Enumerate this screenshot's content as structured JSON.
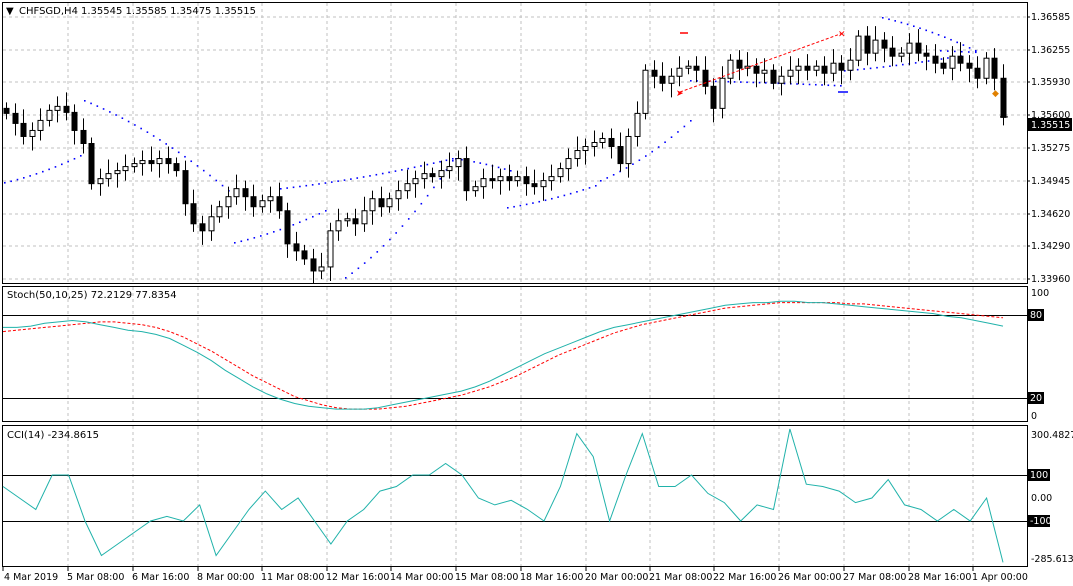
{
  "chart_header": {
    "symbol_timeframe": "CHFSGD,H4",
    "ohlc_text": "1.35545 1.35585 1.35475 1.35515"
  },
  "price_axis": {
    "labels": [
      "1.36585",
      "1.36255",
      "1.35930",
      "1.35600",
      "1.35275",
      "1.34945",
      "1.34620",
      "1.34290",
      "1.33960"
    ],
    "current_price": "1.35515"
  },
  "stoch_panel": {
    "label": "Stoch(50,10,25) 72.2129 77.8354",
    "axis_labels": [
      "100",
      "80",
      "20",
      "0"
    ]
  },
  "cci_panel": {
    "label": "CCI(14) -234.8615",
    "axis_labels": [
      "300.4827",
      "100",
      "0.00",
      "-100",
      "-285.6135"
    ]
  },
  "time_axis": {
    "labels": [
      "4 Mar 2019",
      "5 Mar 08:00",
      "6 Mar 16:00",
      "8 Mar 00:00",
      "11 Mar 08:00",
      "12 Mar 16:00",
      "14 Mar 00:00",
      "15 Mar 08:00",
      "18 Mar 16:00",
      "20 Mar 00:00",
      "21 Mar 08:00",
      "22 Mar 16:00",
      "26 Mar 00:00",
      "27 Mar 08:00",
      "28 Mar 16:00",
      "1 Apr 00:00"
    ]
  },
  "colors": {
    "background": "#ffffff",
    "grid": "#c0c0c0",
    "candle": "#000000",
    "sar_dots": "#0000ff",
    "stoch_main": "#20b2aa",
    "stoch_signal": "#ff0000",
    "cci_line": "#20b2aa",
    "level_line": "#000000",
    "trade_line": "#ff0000"
  },
  "chart_data": {
    "type": "candlestick",
    "symbol": "CHFSGD",
    "timeframe": "H4",
    "ylim": [
      1.3386,
      1.3665
    ],
    "last": 1.35515,
    "close": [
      1.3555,
      1.3545,
      1.3532,
      1.3538,
      1.3548,
      1.3558,
      1.3562,
      1.3556,
      1.3538,
      1.3525,
      1.3485,
      1.349,
      1.3495,
      1.3498,
      1.3502,
      1.3505,
      1.3508,
      1.3505,
      1.351,
      1.3505,
      1.3498,
      1.3465,
      1.3445,
      1.3438,
      1.3452,
      1.3462,
      1.3472,
      1.348,
      1.3472,
      1.3462,
      1.3468,
      1.3472,
      1.3458,
      1.3425,
      1.3418,
      1.341,
      1.3398,
      1.3402,
      1.3438,
      1.3448,
      1.345,
      1.3445,
      1.3458,
      1.347,
      1.3462,
      1.347,
      1.3478,
      1.3485,
      1.349,
      1.3495,
      1.3492,
      1.3498,
      1.3502,
      1.351,
      1.3478,
      1.3482,
      1.349,
      1.3488,
      1.3492,
      1.3488,
      1.3492,
      1.3485,
      1.3482,
      1.3488,
      1.3492,
      1.35,
      1.351,
      1.3518,
      1.3522,
      1.3526,
      1.353,
      1.3522,
      1.3505,
      1.3532,
      1.3555,
      1.3598,
      1.3592,
      1.3585,
      1.3592,
      1.36,
      1.3602,
      1.3598,
      1.3582,
      1.356,
      1.359,
      1.3608,
      1.36,
      1.3602,
      1.3595,
      1.3598,
      1.3585,
      1.3592,
      1.3598,
      1.3602,
      1.3598,
      1.3602,
      1.3595,
      1.3605,
      1.3598,
      1.3608,
      1.3632,
      1.3615,
      1.3628,
      1.362,
      1.3612,
      1.3615,
      1.3625,
      1.3615,
      1.3612,
      1.3605,
      1.36,
      1.3612,
      1.3605,
      1.36,
      1.359,
      1.361,
      1.359,
      1.3551
    ],
    "open": [
      1.356,
      1.3555,
      1.3545,
      1.3532,
      1.3538,
      1.3548,
      1.3558,
      1.3562,
      1.3556,
      1.3538,
      1.3525,
      1.3485,
      1.349,
      1.3495,
      1.3498,
      1.3502,
      1.3505,
      1.3508,
      1.3505,
      1.351,
      1.3505,
      1.3498,
      1.3465,
      1.3445,
      1.3438,
      1.3452,
      1.3462,
      1.3472,
      1.348,
      1.3472,
      1.3462,
      1.3468,
      1.3472,
      1.3458,
      1.3425,
      1.3418,
      1.341,
      1.3398,
      1.3402,
      1.3438,
      1.3448,
      1.345,
      1.3445,
      1.3458,
      1.347,
      1.3462,
      1.347,
      1.3478,
      1.3485,
      1.349,
      1.3495,
      1.3492,
      1.3498,
      1.3502,
      1.351,
      1.3478,
      1.3482,
      1.349,
      1.3488,
      1.3492,
      1.3488,
      1.3492,
      1.3485,
      1.3482,
      1.3488,
      1.3492,
      1.35,
      1.351,
      1.3518,
      1.3522,
      1.3526,
      1.353,
      1.3522,
      1.3505,
      1.3532,
      1.3555,
      1.3598,
      1.3592,
      1.3585,
      1.3592,
      1.36,
      1.3602,
      1.3598,
      1.3582,
      1.356,
      1.359,
      1.3608,
      1.36,
      1.3602,
      1.3595,
      1.3598,
      1.3585,
      1.3592,
      1.3598,
      1.3602,
      1.3598,
      1.3602,
      1.3595,
      1.3605,
      1.3598,
      1.3608,
      1.3632,
      1.3615,
      1.3628,
      1.362,
      1.3612,
      1.3615,
      1.3625,
      1.3615,
      1.3612,
      1.3605,
      1.36,
      1.3612,
      1.3605,
      1.36,
      1.359,
      1.361,
      1.359
    ],
    "stoch_main": [
      71,
      71,
      72,
      74,
      75,
      76,
      75,
      73,
      71,
      69,
      68,
      66,
      63,
      58,
      53,
      47,
      40,
      34,
      28,
      23,
      19,
      16,
      14,
      13,
      12,
      12,
      12,
      13,
      15,
      17,
      19,
      21,
      23,
      25,
      28,
      32,
      37,
      42,
      47,
      52,
      56,
      60,
      64,
      68,
      71,
      73,
      75,
      77,
      79,
      81,
      83,
      85,
      87,
      88,
      89,
      89,
      90,
      90,
      89,
      89,
      88,
      87,
      86,
      85,
      84,
      83,
      82,
      81,
      79,
      78,
      76,
      74,
      72
    ],
    "stoch_signal": [
      68,
      69,
      70,
      71,
      72,
      73,
      74,
      75,
      75,
      74,
      73,
      71,
      68,
      64,
      59,
      54,
      48,
      42,
      36,
      31,
      26,
      21,
      18,
      15,
      13,
      12,
      12,
      12,
      13,
      14,
      16,
      18,
      20,
      22,
      25,
      28,
      32,
      36,
      41,
      46,
      51,
      55,
      59,
      63,
      67,
      70,
      73,
      75,
      77,
      79,
      81,
      83,
      85,
      86,
      87,
      88,
      89,
      89,
      89,
      89,
      89,
      88,
      88,
      87,
      86,
      85,
      84,
      83,
      82,
      81,
      80,
      79,
      78
    ],
    "cci": [
      50,
      0,
      -50,
      100,
      100,
      -100,
      -250,
      -200,
      -150,
      -100,
      -80,
      -100,
      -30,
      -250,
      -150,
      -50,
      30,
      -50,
      0,
      -100,
      -200,
      -100,
      -50,
      30,
      50,
      100,
      100,
      150,
      100,
      0,
      -30,
      -10,
      -50,
      -100,
      50,
      280,
      180,
      -100,
      100,
      280,
      50,
      50,
      100,
      20,
      -20,
      -100,
      -30,
      -50,
      300,
      60,
      50,
      30,
      -20,
      0,
      80,
      -30,
      -50,
      -100,
      -50,
      -100,
      0,
      -280
    ]
  }
}
